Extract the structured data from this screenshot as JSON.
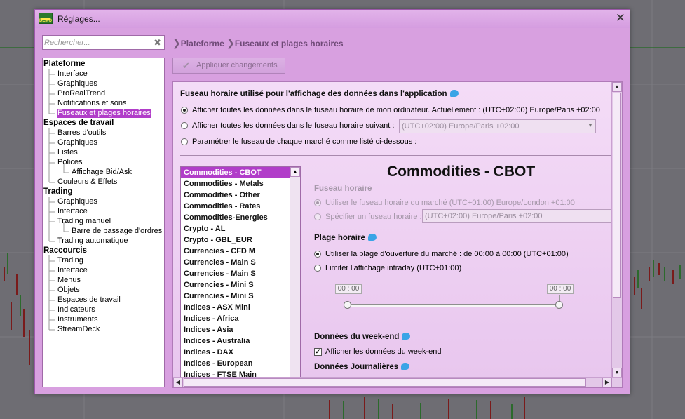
{
  "window": {
    "title": "Réglages...",
    "close_glyph": "✕",
    "app_icon_text": "DEMO"
  },
  "search": {
    "placeholder": "Rechercher...",
    "clear_glyph": "✖"
  },
  "sidebar": {
    "categories": [
      {
        "label": "Plateforme",
        "items": [
          "Interface",
          "Graphiques",
          "ProRealTrend",
          "Notifications et sons",
          "Fuseaux et plages horaires"
        ]
      },
      {
        "label": "Espaces de travail",
        "items": [
          "Barres d'outils",
          "Graphiques",
          "Listes",
          "Polices",
          "Affichage Bid/Ask",
          "Couleurs & Effets"
        ]
      },
      {
        "label": "Trading",
        "items": [
          "Graphiques",
          "Interface",
          "Trading manuel",
          "Barre de passage d'ordres",
          "Trading automatique"
        ]
      },
      {
        "label": "Raccourcis",
        "items": [
          "Trading",
          "Interface",
          "Menus",
          "Objets",
          "Espaces de travail",
          "Indicateurs",
          "Instruments",
          "StreamDeck"
        ]
      }
    ],
    "selected": "Fuseaux et plages horaires"
  },
  "breadcrumb": {
    "sep": "❯",
    "items": [
      "Plateforme",
      "Fuseaux et plages horaires"
    ]
  },
  "toolbar": {
    "apply_label": "Appliquer changements",
    "apply_icon": "check-icon"
  },
  "timezone": {
    "heading": "Fuseau horaire utilisé pour l'affichage des données dans l'application",
    "option_computer": "Afficher toutes les données dans le fuseau horaire de mon ordinateur. Actuellement : (UTC+02:00) Europe/Paris +02:00",
    "option_following": "Afficher toutes les données dans le fuseau horaire suivant :",
    "option_following_value": "(UTC+02:00) Europe/Paris +02:00",
    "option_per_market": "Paramétrer le fuseau de chaque marché comme listé ci-dessous :",
    "selected": "option_computer"
  },
  "markets": {
    "list": [
      "Commodities - CBOT",
      "Commodities - Metals",
      "Commodities - Other",
      "Commodities - Rates",
      "Commodities-Energies",
      "Crypto - AL",
      "Crypto - GBL_EUR",
      "Currencies - CFD M",
      "Currencies - Main S",
      "Currencies - Main S",
      "Currencies - Mini S",
      "Currencies - Mini S",
      "Indices - ASX Mini",
      "Indices - Africa",
      "Indices - Asia",
      "Indices - Australia",
      "Indices - DAX",
      "Indices - European",
      "Indices - FTSE Main"
    ],
    "selected": "Commodities - CBOT"
  },
  "detail": {
    "title": "Commodities - CBOT",
    "tz_heading": "Fuseau horaire",
    "tz_market": "Utiliser le fuseau horaire du marché (UTC+01:00) Europe/London +01:00",
    "tz_specific": "Spécifier un fuseau horaire :",
    "tz_specific_value": "(UTC+02:00) Europe/Paris +02:00",
    "hours_heading": "Plage horaire",
    "hours_market": "Utiliser la plage d'ouverture du marché : de 00:00 à 00:00  (UTC+01:00)",
    "hours_limit": "Limiter l'affichage intraday  (UTC+01:00)",
    "slider_start": "00 : 00",
    "slider_end": "00 : 00",
    "weekend_heading": "Données du week-end",
    "weekend_check": "Afficher les données du week-end",
    "weekend_checked": true,
    "daily_heading": "Données Journalières"
  },
  "colors": {
    "accent": "#b13dc9",
    "dialog_bg": "#d8a0e0",
    "info_icon": "#3aa4e6"
  }
}
